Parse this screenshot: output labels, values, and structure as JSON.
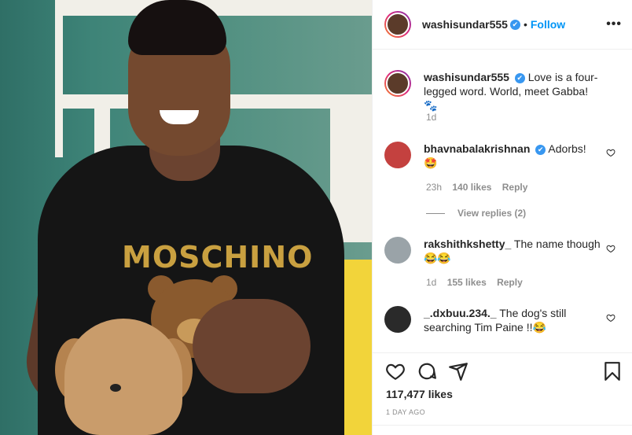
{
  "post": {
    "author": "washisundar555",
    "follow_label": "Follow",
    "more_label": "•••",
    "verified_mark": "✔",
    "separator": "•",
    "image_text": "MOSCHINO"
  },
  "caption": {
    "username": "washisundar555",
    "text": "Love is a four-legged word. World, meet Gabba! 🐾",
    "time": "1d"
  },
  "comments": [
    {
      "username": "bhavnabalakrishnan",
      "text": "Adorbs! 🤩",
      "time": "23h",
      "likes": "140 likes",
      "reply": "Reply",
      "avatar_color": "#c4413f"
    },
    {
      "username": "rakshithkshetty_",
      "text": "The name though😂😂",
      "time": "1d",
      "likes": "155 likes",
      "reply": "Reply",
      "avatar_color": "#9aa3a8"
    },
    {
      "username": "_.dxbuu.234._",
      "text": "The dog's still searching Tim Paine !!😂",
      "avatar_color": "#2a2a2a"
    }
  ],
  "view_replies": "View replies (2)",
  "likes_count": "117,477 likes",
  "post_date": "1 DAY AGO",
  "icons": {
    "like": "heart-icon",
    "comment": "comment-icon",
    "share": "share-icon",
    "save": "bookmark-icon"
  },
  "colors": {
    "accent": "#0095f6",
    "verified": "#3897f0",
    "muted": "#8e8e8e"
  }
}
